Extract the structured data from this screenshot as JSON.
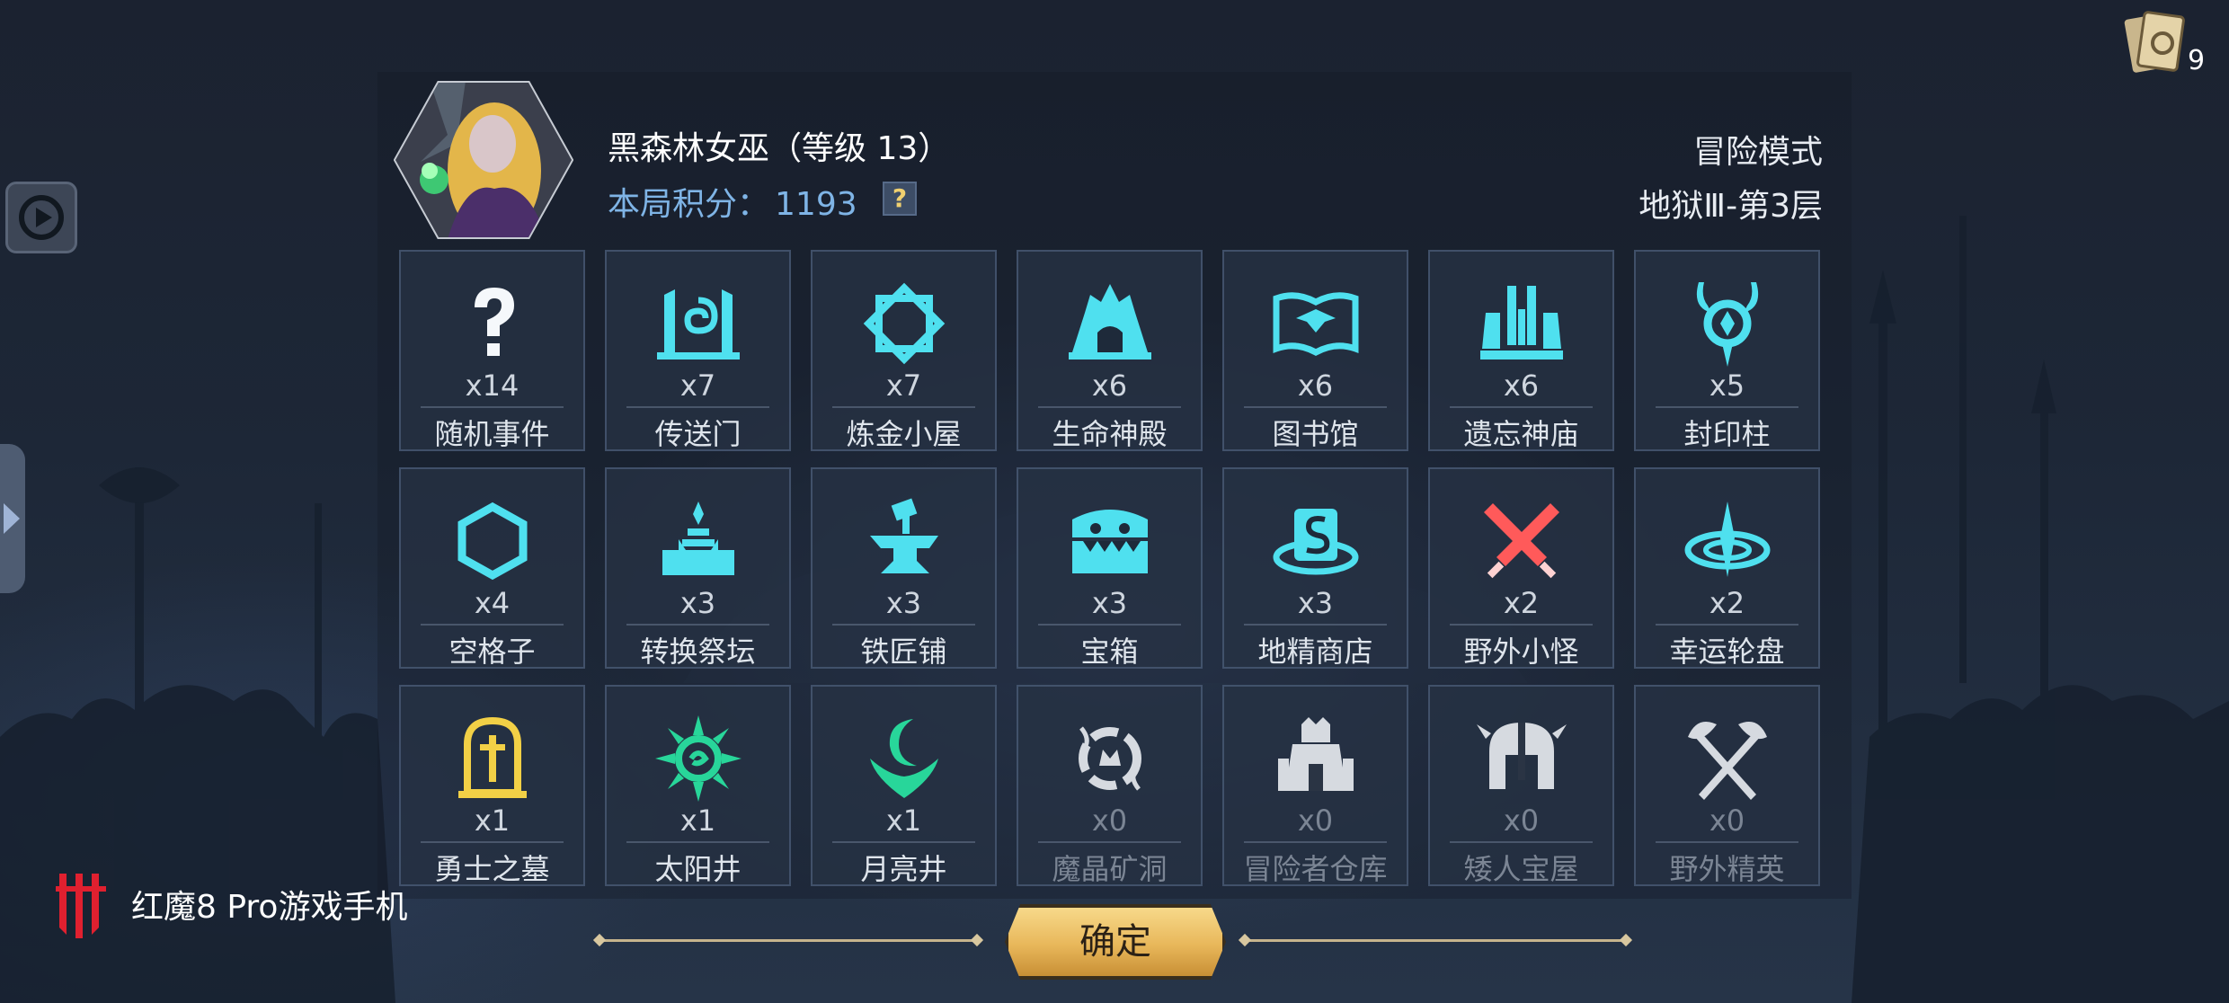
{
  "header": {
    "hero_title": "黑森林女巫（等级 13）",
    "score_label": "本局积分：",
    "score_value": "1193",
    "help_label": "?",
    "mode": "冒险模式",
    "floor": "地狱Ⅲ-第3层"
  },
  "tiles": [
    {
      "icon": "question-mark-icon",
      "count": "x14",
      "name": "随机事件"
    },
    {
      "icon": "portal-icon",
      "count": "x7",
      "name": "传送门"
    },
    {
      "icon": "alchemy-icon",
      "count": "x7",
      "name": "炼金小屋"
    },
    {
      "icon": "life-temple-icon",
      "count": "x6",
      "name": "生命神殿"
    },
    {
      "icon": "open-book-icon",
      "count": "x6",
      "name": "图书馆"
    },
    {
      "icon": "forgotten-temple-icon",
      "count": "x6",
      "name": "遗忘神庙"
    },
    {
      "icon": "seal-pillar-icon",
      "count": "x5",
      "name": "封印柱"
    },
    {
      "icon": "hexagon-icon",
      "count": "x4",
      "name": "空格子"
    },
    {
      "icon": "altar-icon",
      "count": "x3",
      "name": "转换祭坛"
    },
    {
      "icon": "anvil-icon",
      "count": "x3",
      "name": "铁匠铺"
    },
    {
      "icon": "treasure-chest-icon",
      "count": "x3",
      "name": "宝箱"
    },
    {
      "icon": "goblin-shop-icon",
      "count": "x3",
      "name": "地精商店"
    },
    {
      "icon": "crossed-swords-icon",
      "count": "x2",
      "name": "野外小怪"
    },
    {
      "icon": "lucky-wheel-icon",
      "count": "x2",
      "name": "幸运轮盘"
    },
    {
      "icon": "warrior-tomb-icon",
      "count": "x1",
      "name": "勇士之墓"
    },
    {
      "icon": "sun-well-icon",
      "count": "x1",
      "name": "太阳井"
    },
    {
      "icon": "moon-well-icon",
      "count": "x1",
      "name": "月亮井"
    },
    {
      "icon": "crystal-mine-icon",
      "count": "x0",
      "name": "魔晶矿洞"
    },
    {
      "icon": "adventurer-warehouse-icon",
      "count": "x0",
      "name": "冒险者仓库"
    },
    {
      "icon": "dwarf-helmet-icon",
      "count": "x0",
      "name": "矮人宝屋"
    },
    {
      "icon": "crossed-axes-icon",
      "count": "x0",
      "name": "野外精英"
    }
  ],
  "confirm_label": "确定",
  "brand_text": "红魔8 Pro游戏手机",
  "deck_count": "9",
  "colors": {
    "icon_cyan": "#4fe0ef",
    "icon_gold": "#f2d046",
    "icon_green": "#28d69a",
    "icon_red": "#ff5a5a",
    "icon_grey": "#d6dae0",
    "score_blue": "#7fb4e6",
    "button_gold": "#e8b75a",
    "brand_red": "#e0202f"
  }
}
